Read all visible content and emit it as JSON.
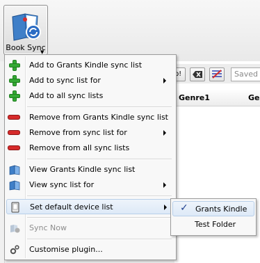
{
  "toolbar": {
    "book_sync_label": "Book Sync",
    "saved_search_placeholder": "Saved S"
  },
  "table": {
    "columns": [
      "Genre1",
      "Genr"
    ]
  },
  "menu": {
    "items": [
      {
        "label": "Add to Grants Kindle sync list",
        "icon": "add-icon",
        "submenu": false,
        "enabled": true
      },
      {
        "label": "Add to sync list for",
        "icon": "add-icon",
        "submenu": true,
        "enabled": true
      },
      {
        "label": "Add to all sync lists",
        "icon": "add-icon",
        "submenu": false,
        "enabled": true
      },
      {
        "label": "Remove from Grants Kindle sync list",
        "icon": "remove-icon",
        "submenu": false,
        "enabled": true
      },
      {
        "label": "Remove from sync list for",
        "icon": "remove-icon",
        "submenu": true,
        "enabled": true
      },
      {
        "label": "Remove from all sync lists",
        "icon": "remove-icon",
        "submenu": false,
        "enabled": true
      },
      {
        "label": "View Grants Kindle sync list",
        "icon": "book-icon",
        "submenu": false,
        "enabled": true
      },
      {
        "label": "View sync list for",
        "icon": "book-icon",
        "submenu": true,
        "enabled": true
      },
      {
        "label": "Set default device list",
        "icon": "device-icon",
        "submenu": true,
        "enabled": true
      },
      {
        "label": "Sync Now",
        "icon": "sync-icon",
        "submenu": false,
        "enabled": false
      },
      {
        "label": "Customise plugin...",
        "icon": "gear-icon",
        "submenu": false,
        "enabled": true
      }
    ]
  },
  "submenu": {
    "items": [
      {
        "label": "Grants Kindle",
        "checked": true
      },
      {
        "label": "Test Folder",
        "checked": false
      }
    ]
  }
}
